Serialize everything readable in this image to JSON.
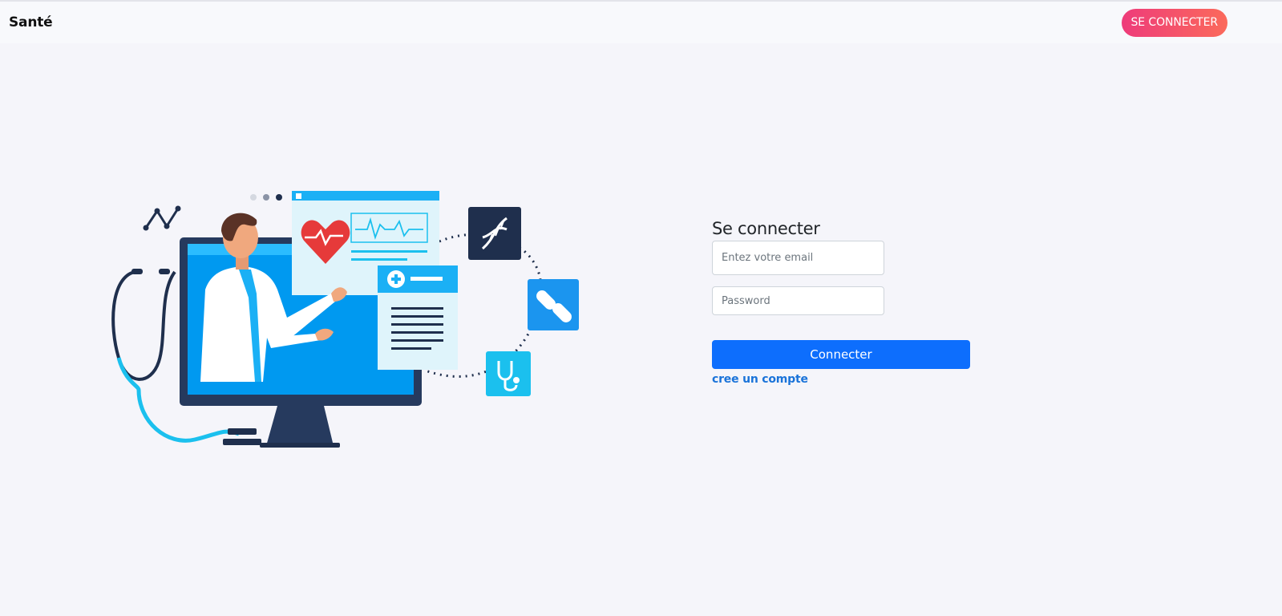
{
  "navbar": {
    "brand": "Santé",
    "login_button": "SE CONNECTER"
  },
  "illustration": {
    "icons": [
      "heartbeat-icon",
      "medical-report-icon",
      "dna-icon",
      "pills-icon",
      "stethoscope-icon",
      "chart-line-icon"
    ]
  },
  "login": {
    "title": "Se connecter",
    "email_placeholder": "Entez votre email",
    "email_value": "",
    "password_placeholder": "Password",
    "password_value": "",
    "submit_label": "Connecter",
    "create_account_link": "cree un compte"
  },
  "colors": {
    "background": "#f5f5fa",
    "primary": "#0d6efd",
    "accent_gradient_start": "#ee3b7a",
    "accent_gradient_end": "#fb6a5b",
    "link": "#1a73d9"
  }
}
